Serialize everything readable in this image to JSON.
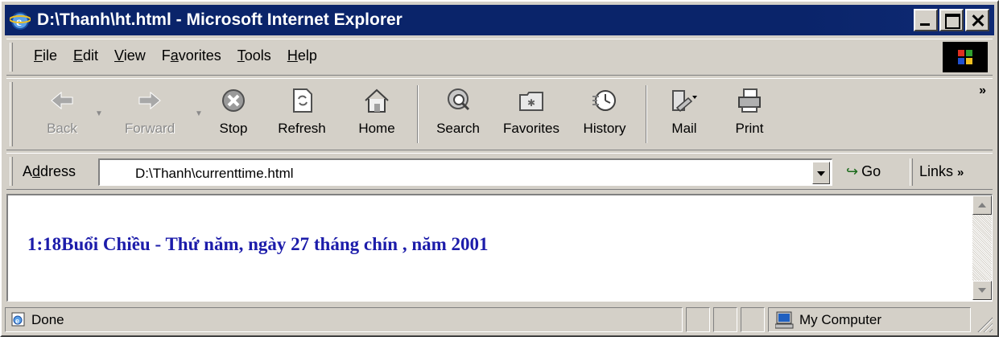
{
  "window": {
    "title": "D:\\Thanh\\ht.html - Microsoft Internet Explorer"
  },
  "menu": {
    "items": [
      {
        "pre": "",
        "key": "F",
        "post": "ile"
      },
      {
        "pre": "",
        "key": "E",
        "post": "dit"
      },
      {
        "pre": "",
        "key": "V",
        "post": "iew"
      },
      {
        "pre": "F",
        "key": "a",
        "post": "vorites"
      },
      {
        "pre": "",
        "key": "T",
        "post": "ools"
      },
      {
        "pre": "",
        "key": "H",
        "post": "elp"
      }
    ]
  },
  "toolbar": {
    "back": "Back",
    "forward": "Forward",
    "stop": "Stop",
    "refresh": "Refresh",
    "home": "Home",
    "search": "Search",
    "favorites": "Favorites",
    "history": "History",
    "mail": "Mail",
    "print": "Print",
    "more": "»"
  },
  "address": {
    "label_pre": "A",
    "label_key": "d",
    "label_post": "dress",
    "value": "D:\\Thanh\\currenttime.html",
    "go": "Go",
    "links": "Links",
    "links_more": "»"
  },
  "content": {
    "text": "1:18Buổi Chiều - Thứ năm, ngày 27 tháng chín , năm 2001"
  },
  "status": {
    "text": "Done",
    "zone": "My Computer"
  },
  "colors": {
    "title_bg": "#0a246a",
    "page_text": "#1c1caa",
    "chrome": "#d4d0c8"
  }
}
